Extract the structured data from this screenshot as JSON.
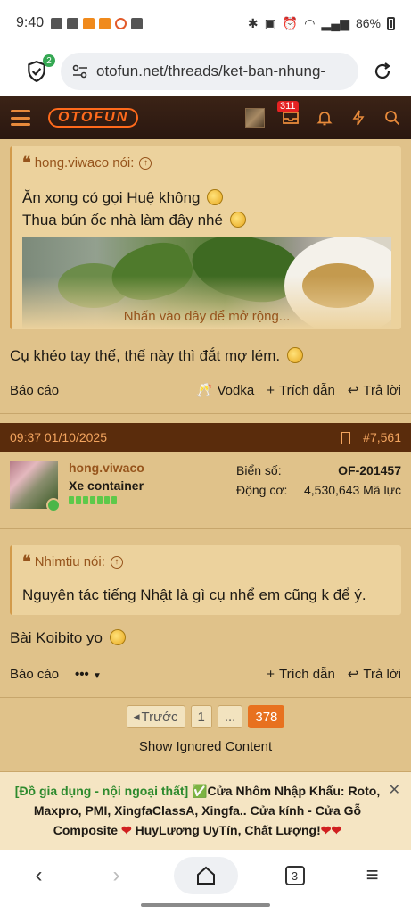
{
  "status_bar": {
    "time": "9:40",
    "battery": "86%"
  },
  "address_bar": {
    "url": "otofun.net/threads/ket-ban-nhung-",
    "shield_badge": "2"
  },
  "site_header": {
    "logo": "OTOFUN",
    "inbox_count": "311"
  },
  "post1": {
    "quote": {
      "author": "hong.viwaco nói:",
      "line1": "Ăn xong có gọi Huệ không",
      "line2": "Thua bún ốc nhà làm đây nhé",
      "expand": "Nhấn vào đây để mở rộng..."
    },
    "text": "Cụ khéo tay thế, thế này thì đắt mợ lém.",
    "actions": {
      "report": "Báo cáo",
      "reaction": "Vodka",
      "quote": "Trích dẫn",
      "reply": "Trả lời"
    }
  },
  "post2": {
    "header": {
      "datetime": "09:37 01/10/2025",
      "number": "#7,561"
    },
    "user": {
      "name": "hong.viwaco",
      "title": "Xe container"
    },
    "stats": {
      "plate_label": "Biển số:",
      "plate_value": "OF-201457",
      "engine_label": "Động cơ:",
      "engine_value": "4,530,643 Mã lực"
    },
    "quote": {
      "author": "Nhimtiu nói:",
      "text": "Nguyên tác tiếng Nhật là gì cụ nhể em cũng k để ý."
    },
    "text": "Bài Koibito yo",
    "actions": {
      "report": "Báo cáo",
      "more": "•••",
      "quote": "Trích dẫn",
      "reply": "Trả lời"
    }
  },
  "pagination": {
    "prev": "Trước",
    "first": "1",
    "ellipsis": "...",
    "current": "378"
  },
  "ignored": "Show Ignored Content",
  "ad": {
    "green": "[Đồ gia dụng - nội ngoại thất]",
    "text": "Cửa Nhôm Nhập Khẩu: Roto, Maxpro, PMI, XingfaClassA, Xingfa.. Cửa kính - Cửa Gỗ Composite",
    "tail": "HuyLương UyTín, Chất Lượng!"
  },
  "bottom_nav": {
    "tabs": "3"
  }
}
